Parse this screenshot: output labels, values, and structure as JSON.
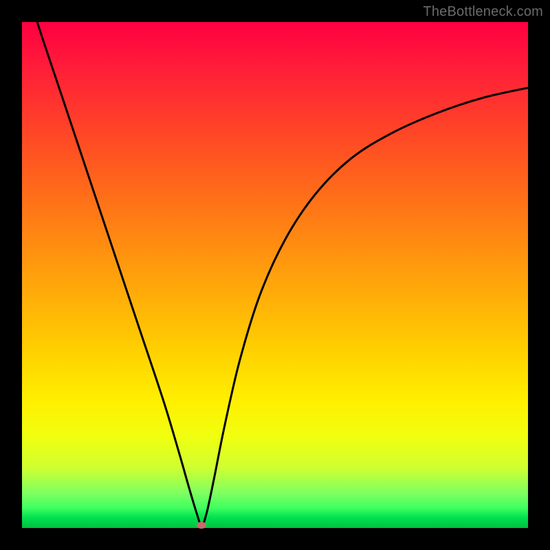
{
  "watermark": "TheBottleneck.com",
  "colors": {
    "background": "#000000",
    "curve": "#000000",
    "dot": "#c96a6a",
    "gradient_top": "#ff0040",
    "gradient_bottom": "#00c040"
  },
  "chart_data": {
    "type": "line",
    "title": "",
    "xlabel": "",
    "ylabel": "",
    "xlim": [
      0,
      100
    ],
    "ylim": [
      0,
      100
    ],
    "grid": false,
    "series": [
      {
        "name": "bottleneck-curve",
        "x": [
          0,
          3,
          8,
          13,
          18,
          23,
          28,
          31,
          33,
          34.5,
          35.5,
          36.5,
          38,
          40,
          43,
          47,
          52,
          58,
          65,
          73,
          82,
          91,
          100
        ],
        "y": [
          110,
          100,
          85,
          70,
          55,
          40,
          25,
          15,
          8,
          3,
          0.5,
          3,
          10,
          20,
          33,
          46,
          57,
          66,
          73,
          78,
          82,
          85,
          87
        ]
      }
    ],
    "annotations": [
      {
        "name": "minimum-point",
        "x": 35.5,
        "y": 0.5
      }
    ]
  }
}
